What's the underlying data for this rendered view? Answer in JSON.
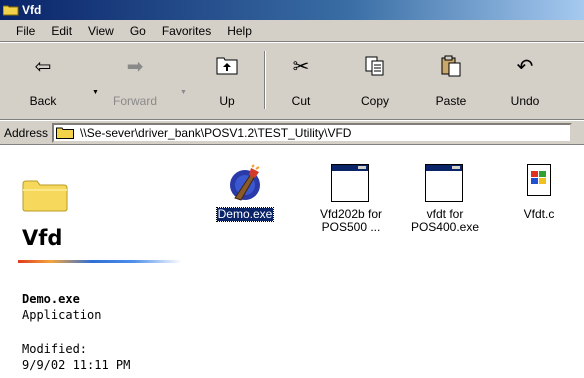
{
  "window": {
    "title": "Vfd"
  },
  "menu": [
    {
      "label": "File"
    },
    {
      "label": "Edit"
    },
    {
      "label": "View"
    },
    {
      "label": "Go"
    },
    {
      "label": "Favorites"
    },
    {
      "label": "Help"
    }
  ],
  "toolbar": {
    "back": "Back",
    "forward": "Forward",
    "up": "Up",
    "cut": "Cut",
    "copy": "Copy",
    "paste": "Paste",
    "undo": "Undo"
  },
  "address": {
    "label": "Address",
    "value": "\\\\Se-sever\\driver_bank\\POSV1.2\\TEST_Utility\\VFD"
  },
  "left_pane": {
    "folder_title": "Vfd",
    "selected_name": "Demo.exe",
    "selected_type": "Application",
    "modified_label": "Modified:",
    "modified_value": "9/9/02 11:11 PM"
  },
  "files": [
    {
      "line1": "Demo.exe",
      "line2": "",
      "icon": "demo-app-icon",
      "selected": true
    },
    {
      "line1": "Vfd202b for",
      "line2": "POS500 ...",
      "icon": "window-app-icon",
      "selected": false
    },
    {
      "line1": "vfdt for",
      "line2": "POS400.exe",
      "icon": "window-app-icon",
      "selected": false
    },
    {
      "line1": "Vfdt.c",
      "line2": "",
      "icon": "c-source-file-icon",
      "selected": false
    }
  ],
  "colors": {
    "titlebar": "#0a246a",
    "selection": "#0a246a",
    "chrome": "#d4d0c8"
  }
}
